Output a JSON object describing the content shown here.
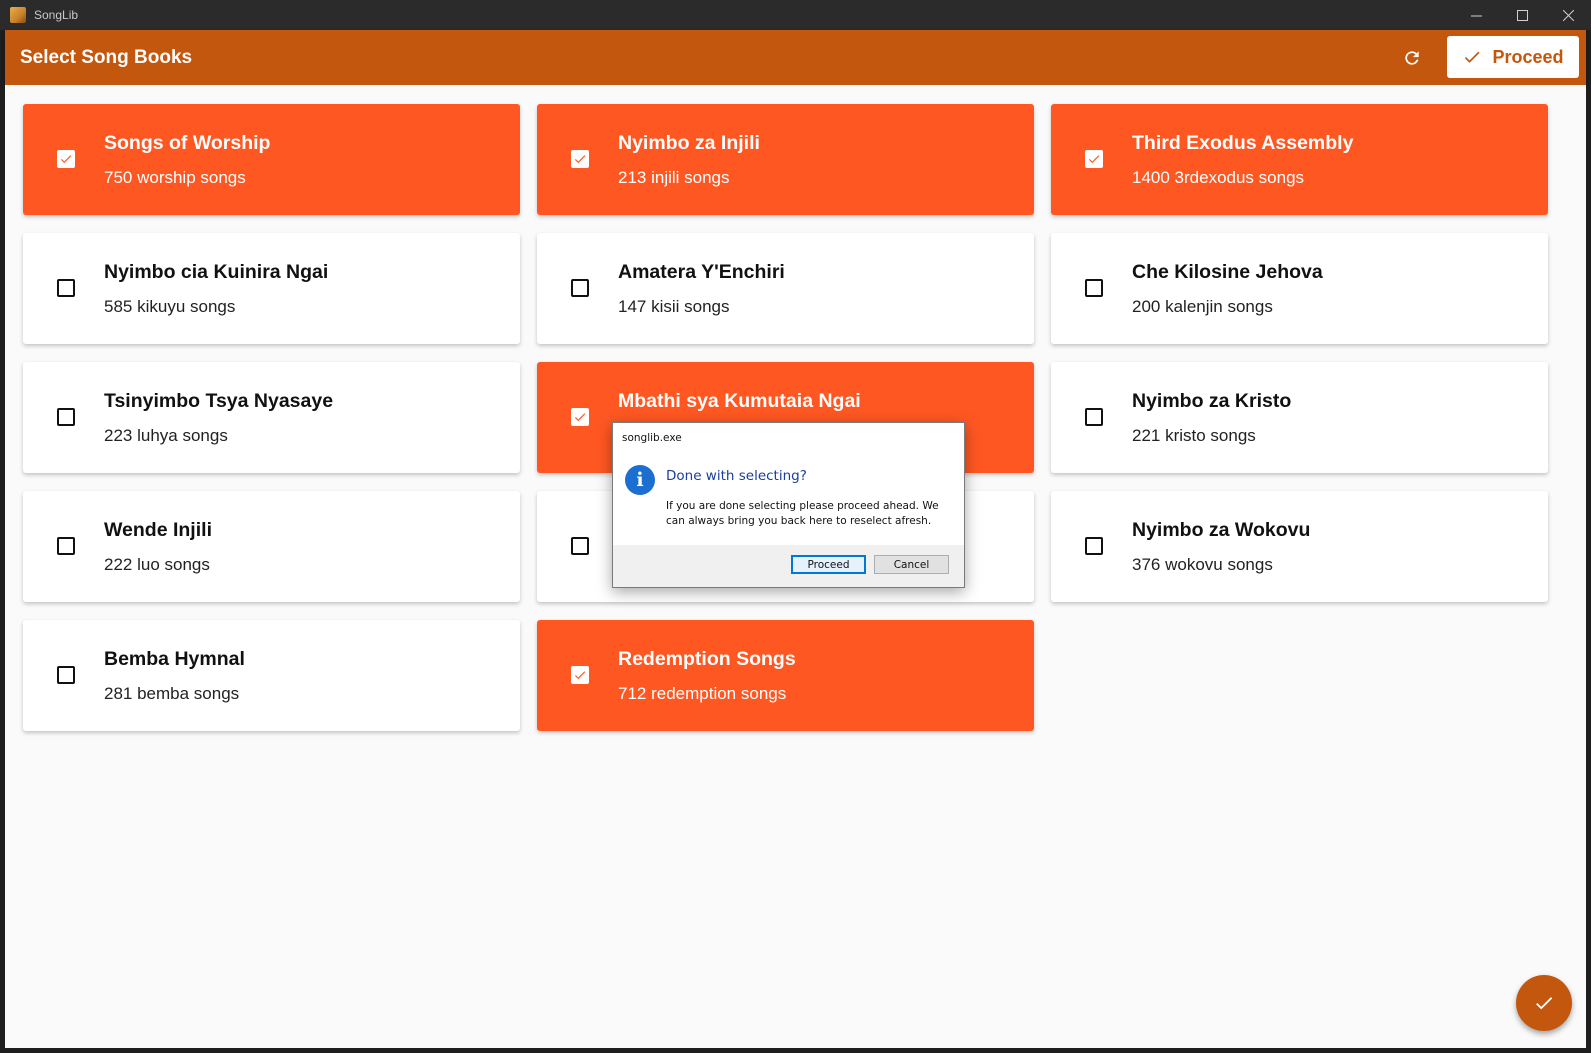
{
  "window": {
    "title": "SongLib",
    "controls": {
      "minimize": "—",
      "maximize": "☐",
      "close": "✕"
    }
  },
  "appbar": {
    "title": "Select Song Books",
    "refresh_icon": "refresh-icon",
    "proceed_label": "Proceed"
  },
  "books": [
    {
      "title": "Songs of Worship",
      "subtitle": "750 worship songs",
      "selected": true
    },
    {
      "title": "Nyimbo za Injili",
      "subtitle": "213 injili songs",
      "selected": true
    },
    {
      "title": "Third Exodus Assembly",
      "subtitle": "1400 3rdexodus songs",
      "selected": true
    },
    {
      "title": "Nyimbo cia Kuinira Ngai",
      "subtitle": "585 kikuyu songs",
      "selected": false
    },
    {
      "title": "Amatera Y'Enchiri",
      "subtitle": "147 kisii songs",
      "selected": false
    },
    {
      "title": "Che Kilosine Jehova",
      "subtitle": "200 kalenjin songs",
      "selected": false
    },
    {
      "title": "Tsinyimbo Tsya Nyasaye",
      "subtitle": "223 luhya songs",
      "selected": false
    },
    {
      "title": "Mbathi sya Kumutaia Ngai",
      "subtitle": "",
      "selected": true
    },
    {
      "title": "Nyimbo za Kristo",
      "subtitle": "221 kristo songs",
      "selected": false
    },
    {
      "title": "Wende Injili",
      "subtitle": "222 luo songs",
      "selected": false
    },
    {
      "title": "",
      "subtitle": "",
      "selected": false
    },
    {
      "title": "Nyimbo za Wokovu",
      "subtitle": "376 wokovu songs",
      "selected": false
    },
    {
      "title": "Bemba Hymnal",
      "subtitle": "281 bemba songs",
      "selected": false
    },
    {
      "title": "Redemption Songs",
      "subtitle": "712 redemption songs",
      "selected": true
    }
  ],
  "dialog": {
    "caption": "songlib.exe",
    "heading": "Done with selecting?",
    "body": "If you are done selecting please proceed ahead. We can always bring you back here to reselect afresh.",
    "proceed_label": "Proceed",
    "cancel_label": "Cancel"
  },
  "colors": {
    "appbar": "#c4570e",
    "selected_card": "#ff5722",
    "fab": "#c4570e"
  }
}
